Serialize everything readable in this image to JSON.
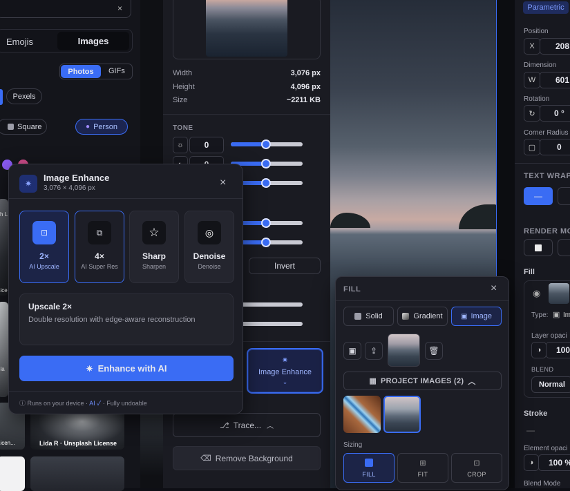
{
  "left_panel": {
    "clear_icon": "×",
    "tabs": [
      "Emojis",
      "Images"
    ],
    "subtabs": [
      "Photos",
      "GIFs"
    ],
    "source": "Pexels",
    "shape_options": [
      "Square",
      "Person"
    ],
    "grid_labels": [
      "sh L",
      "Lice",
      "ola",
      "Licen...",
      "Lida R · Unsplash License"
    ]
  },
  "middle_panel": {
    "info": [
      {
        "label": "Width",
        "value": "3,076 px"
      },
      {
        "label": "Height",
        "value": "4,096 px"
      },
      {
        "label": "Size",
        "value": "~2211 KB"
      }
    ],
    "tone_title": "TONE",
    "tone_values": [
      "0",
      "0"
    ],
    "invert_label": "Invert",
    "image_enhance_label": "Image Enhance",
    "trace_label": "Trace...",
    "remove_bg_label": "Remove Background"
  },
  "enhance_popup": {
    "title": "Image Enhance",
    "subtitle": "3,076 × 4,096 px",
    "options": [
      {
        "title": "2×",
        "sub": "AI Upscale"
      },
      {
        "title": "4×",
        "sub": "AI Super Res"
      },
      {
        "title": "Sharp",
        "sub": "Sharpen"
      },
      {
        "title": "Denoise",
        "sub": "Denoise"
      }
    ],
    "desc_title": "Upscale 2×",
    "desc_text": "Double resolution with edge-aware reconstruction",
    "cta": "Enhance with AI",
    "footer_a": "Runs on your device ·",
    "footer_ai": "AI ✓",
    "footer_b": "· Fully undoable"
  },
  "fill_popup": {
    "title": "FILL",
    "tabs": [
      "Solid",
      "Gradient",
      "Image"
    ],
    "project_images": "PROJECT IMAGES (2)",
    "sizing_label": "Sizing",
    "sizing": [
      "FILL",
      "FIT",
      "CROP"
    ]
  },
  "right_panel": {
    "mode": "Parametric",
    "position_label": "Position",
    "x_label": "X",
    "x_value": "208",
    "dimension_label": "Dimension",
    "w_label": "W",
    "w_value": "601",
    "rotation_label": "Rotation",
    "rotation_value": "0 °",
    "corner_label": "Corner Radius",
    "corner_value": "0",
    "text_wrap": "TEXT WRAP",
    "render_mode": "RENDER MO",
    "fill_label": "Fill",
    "type_label": "Type:",
    "type_value": "Im",
    "layer_opacity": "Layer opaci",
    "layer_opacity_value": "100",
    "blend_label": "BLEND",
    "blend_value": "Normal",
    "stroke_label": "Stroke",
    "stroke_dash": "—",
    "element_opacity": "Element opaci",
    "element_opacity_value": "100 %",
    "blend_mode": "Blend Mode"
  }
}
